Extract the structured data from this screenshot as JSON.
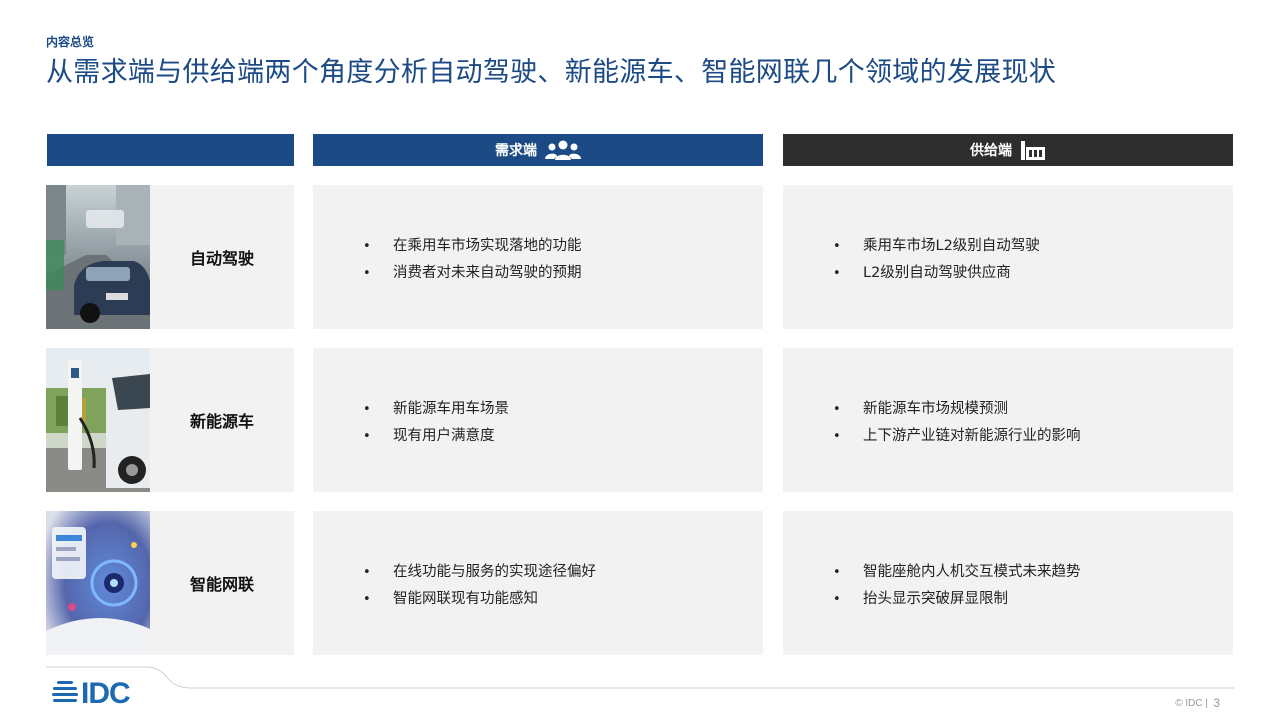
{
  "header": {
    "eyebrow": "内容总览",
    "title": "从需求端与供给端两个角度分析自动驾驶、新能源车、智能网联几个领域的发展现状"
  },
  "columns": {
    "demand_label": "需求端",
    "demand_icon": "people-group-icon",
    "supply_label": "供给端",
    "supply_icon": "factory-icon"
  },
  "rows": [
    {
      "name": "自动驾驶",
      "image_icon": "autonomous-car-photo",
      "demand": [
        "在乘用车市场实现落地的功能",
        "消费者对未来自动驾驶的预期"
      ],
      "supply": [
        "乘用车市场L2级别自动驾驶",
        "L2级别自动驾驶供应商"
      ]
    },
    {
      "name": "新能源车",
      "image_icon": "ev-charging-photo",
      "demand": [
        "新能源车用车场景",
        "现有用户满意度"
      ],
      "supply": [
        "新能源车市场规模预测",
        "上下游产业链对新能源行业的影响"
      ]
    },
    {
      "name": "智能网联",
      "image_icon": "connected-car-photo",
      "demand": [
        "在线功能与服务的实现途径偏好",
        "智能网联现有功能感知"
      ],
      "supply": [
        "智能座舱内人机交互模式未来趋势",
        "抬头显示突破屏显限制"
      ]
    }
  ],
  "footer": {
    "logo_text": "IDC",
    "copyright": "© IDC |",
    "page_number": "3"
  },
  "colors": {
    "brand_blue": "#1b4a84",
    "dark_header": "#2e2e2e",
    "cell_bg": "#f2f2f2",
    "logo_blue": "#1b6ab3"
  }
}
